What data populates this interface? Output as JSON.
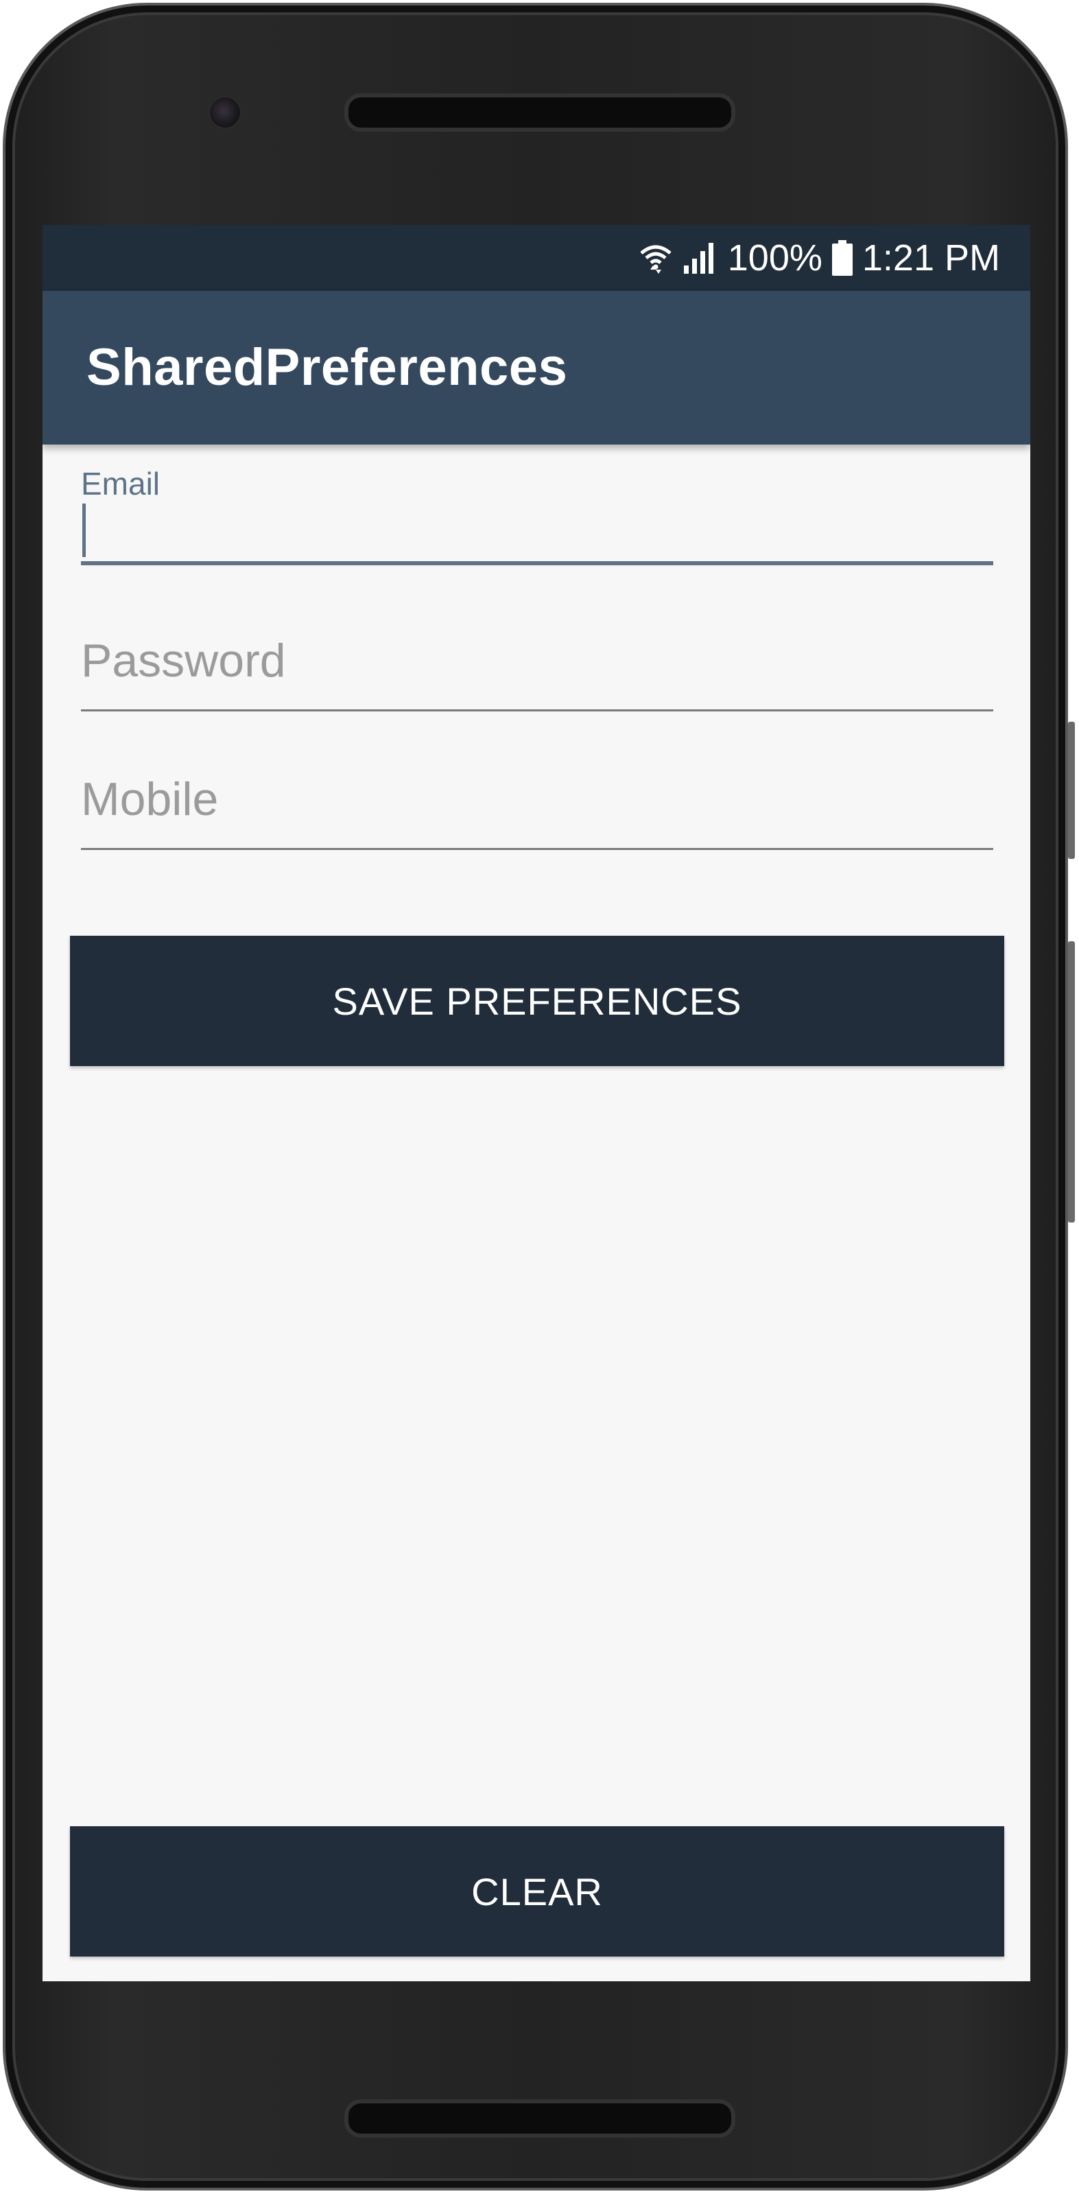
{
  "status_bar": {
    "battery": "100%",
    "time": "1:21 PM",
    "icons": [
      "wifi-icon",
      "signal-icon",
      "battery-icon"
    ]
  },
  "app_bar": {
    "title": "SharedPreferences"
  },
  "form": {
    "email": {
      "label": "Email",
      "value": ""
    },
    "password": {
      "placeholder": "Password",
      "value": ""
    },
    "mobile": {
      "placeholder": "Mobile",
      "value": ""
    },
    "save_label": "SAVE PREFERENCES",
    "clear_label": "CLEAR"
  },
  "colors": {
    "status_bar": "#202d3a",
    "app_bar": "#34495e",
    "button": "#212d3b",
    "screen_background": "#f7f7f7",
    "focused_accent": "#5f7388"
  }
}
